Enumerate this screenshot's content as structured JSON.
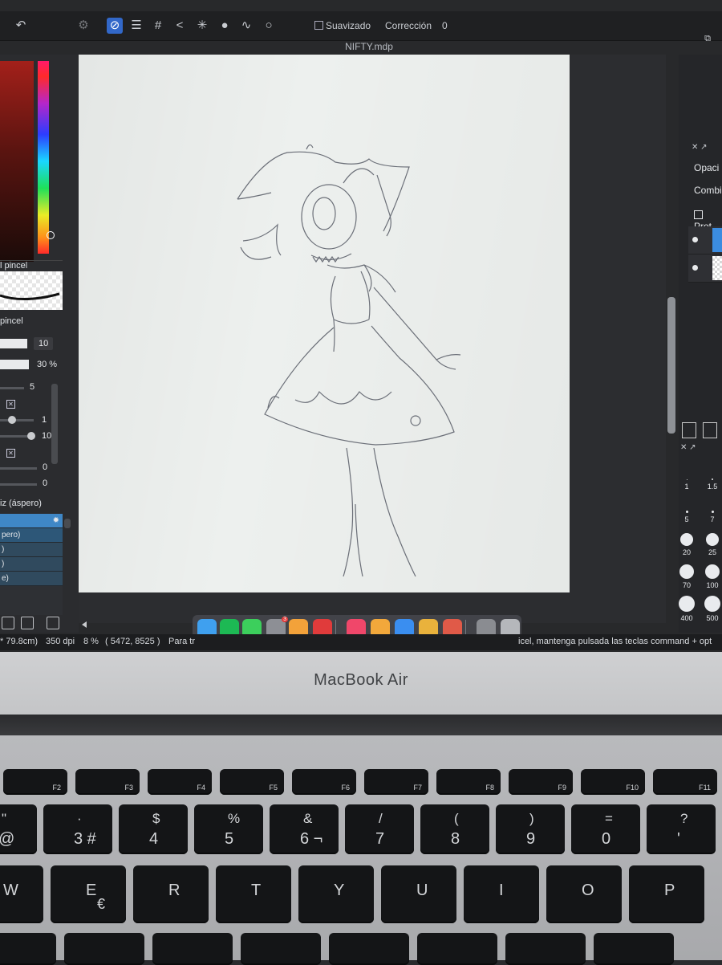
{
  "toolbar": {
    "smoothing_label": "Suavizado",
    "correction_label": "Corrección",
    "correction_value": "0"
  },
  "document": {
    "filename": "NIFTY.mdp"
  },
  "left_panel": {
    "brush_header": "l pincel",
    "brush_section": "pincel",
    "size_value": "10",
    "opacity_value": "30 %",
    "param_a": "5",
    "param_b": "1",
    "param_c": "10",
    "param_d": "0",
    "param_e": "0",
    "brush_list_title": "iz (áspero)",
    "brush_items": [
      "pero)",
      ")",
      ")",
      "e)"
    ]
  },
  "right_panel": {
    "opacity_label": "Opaci",
    "blend_label": "Combi",
    "protect_label": "Prot",
    "brush_sizes": [
      {
        "label": "1"
      },
      {
        "label": "1.5"
      },
      {
        "label": "5"
      },
      {
        "label": "7"
      },
      {
        "label": "20"
      },
      {
        "label": "25"
      },
      {
        "label": "70"
      },
      {
        "label": "100"
      },
      {
        "label": "400"
      },
      {
        "label": "500"
      }
    ]
  },
  "status": {
    "dimensions": "* 79.8cm)",
    "dpi": "350 dpi",
    "zoom": "8 %",
    "coords": "( 5472, 8525 )",
    "hint_left": "Para tr",
    "hint_right": "icel, mantenga pulsada las teclas command + opt"
  },
  "dock": {
    "apps": [
      {
        "name": "finder",
        "color": "#3fa0ef"
      },
      {
        "name": "spotify",
        "color": "#1db954"
      },
      {
        "name": "messages",
        "color": "#3ccf5c"
      },
      {
        "name": "settings",
        "color": "#8d8f95"
      },
      {
        "name": "photos",
        "color": "#f3a23a"
      },
      {
        "name": "app-red",
        "color": "#e03b3b"
      },
      {
        "name": "music",
        "color": "#f0476a"
      },
      {
        "name": "pencil",
        "color": "#f2a83b"
      },
      {
        "name": "freeform",
        "color": "#3a8ef0"
      },
      {
        "name": "chrome",
        "color": "#e9b23c"
      },
      {
        "name": "firealpaca",
        "color": "#e05a48"
      },
      {
        "name": "launchpad",
        "color": "#8a8c91"
      },
      {
        "name": "trash",
        "color": "#b5b7bb"
      }
    ],
    "settings_badge": "3"
  },
  "laptop": {
    "model_label": "MacBook Air"
  },
  "keyboard": {
    "fn_row": [
      "F2",
      "F3",
      "F4",
      "F5",
      "F6",
      "F7",
      "F8",
      "F9",
      "F10",
      "F11"
    ],
    "num_row": [
      {
        "top": "\"",
        "main": "@"
      },
      {
        "top": "·",
        "main": "3 #"
      },
      {
        "top": "$",
        "main": "4"
      },
      {
        "top": "%",
        "main": "5"
      },
      {
        "top": "&",
        "main": "6 ¬"
      },
      {
        "top": "/",
        "main": "7"
      },
      {
        "top": "(",
        "main": "8"
      },
      {
        "top": ")",
        "main": "9"
      },
      {
        "top": "=",
        "main": "0"
      },
      {
        "top": "?",
        "main": "'"
      }
    ],
    "letter_row": [
      {
        "main": "W"
      },
      {
        "main": "E",
        "sub": "€"
      },
      {
        "main": "R"
      },
      {
        "main": "T"
      },
      {
        "main": "Y"
      },
      {
        "main": "U"
      },
      {
        "main": "I"
      },
      {
        "main": "O"
      },
      {
        "main": "P"
      }
    ]
  }
}
